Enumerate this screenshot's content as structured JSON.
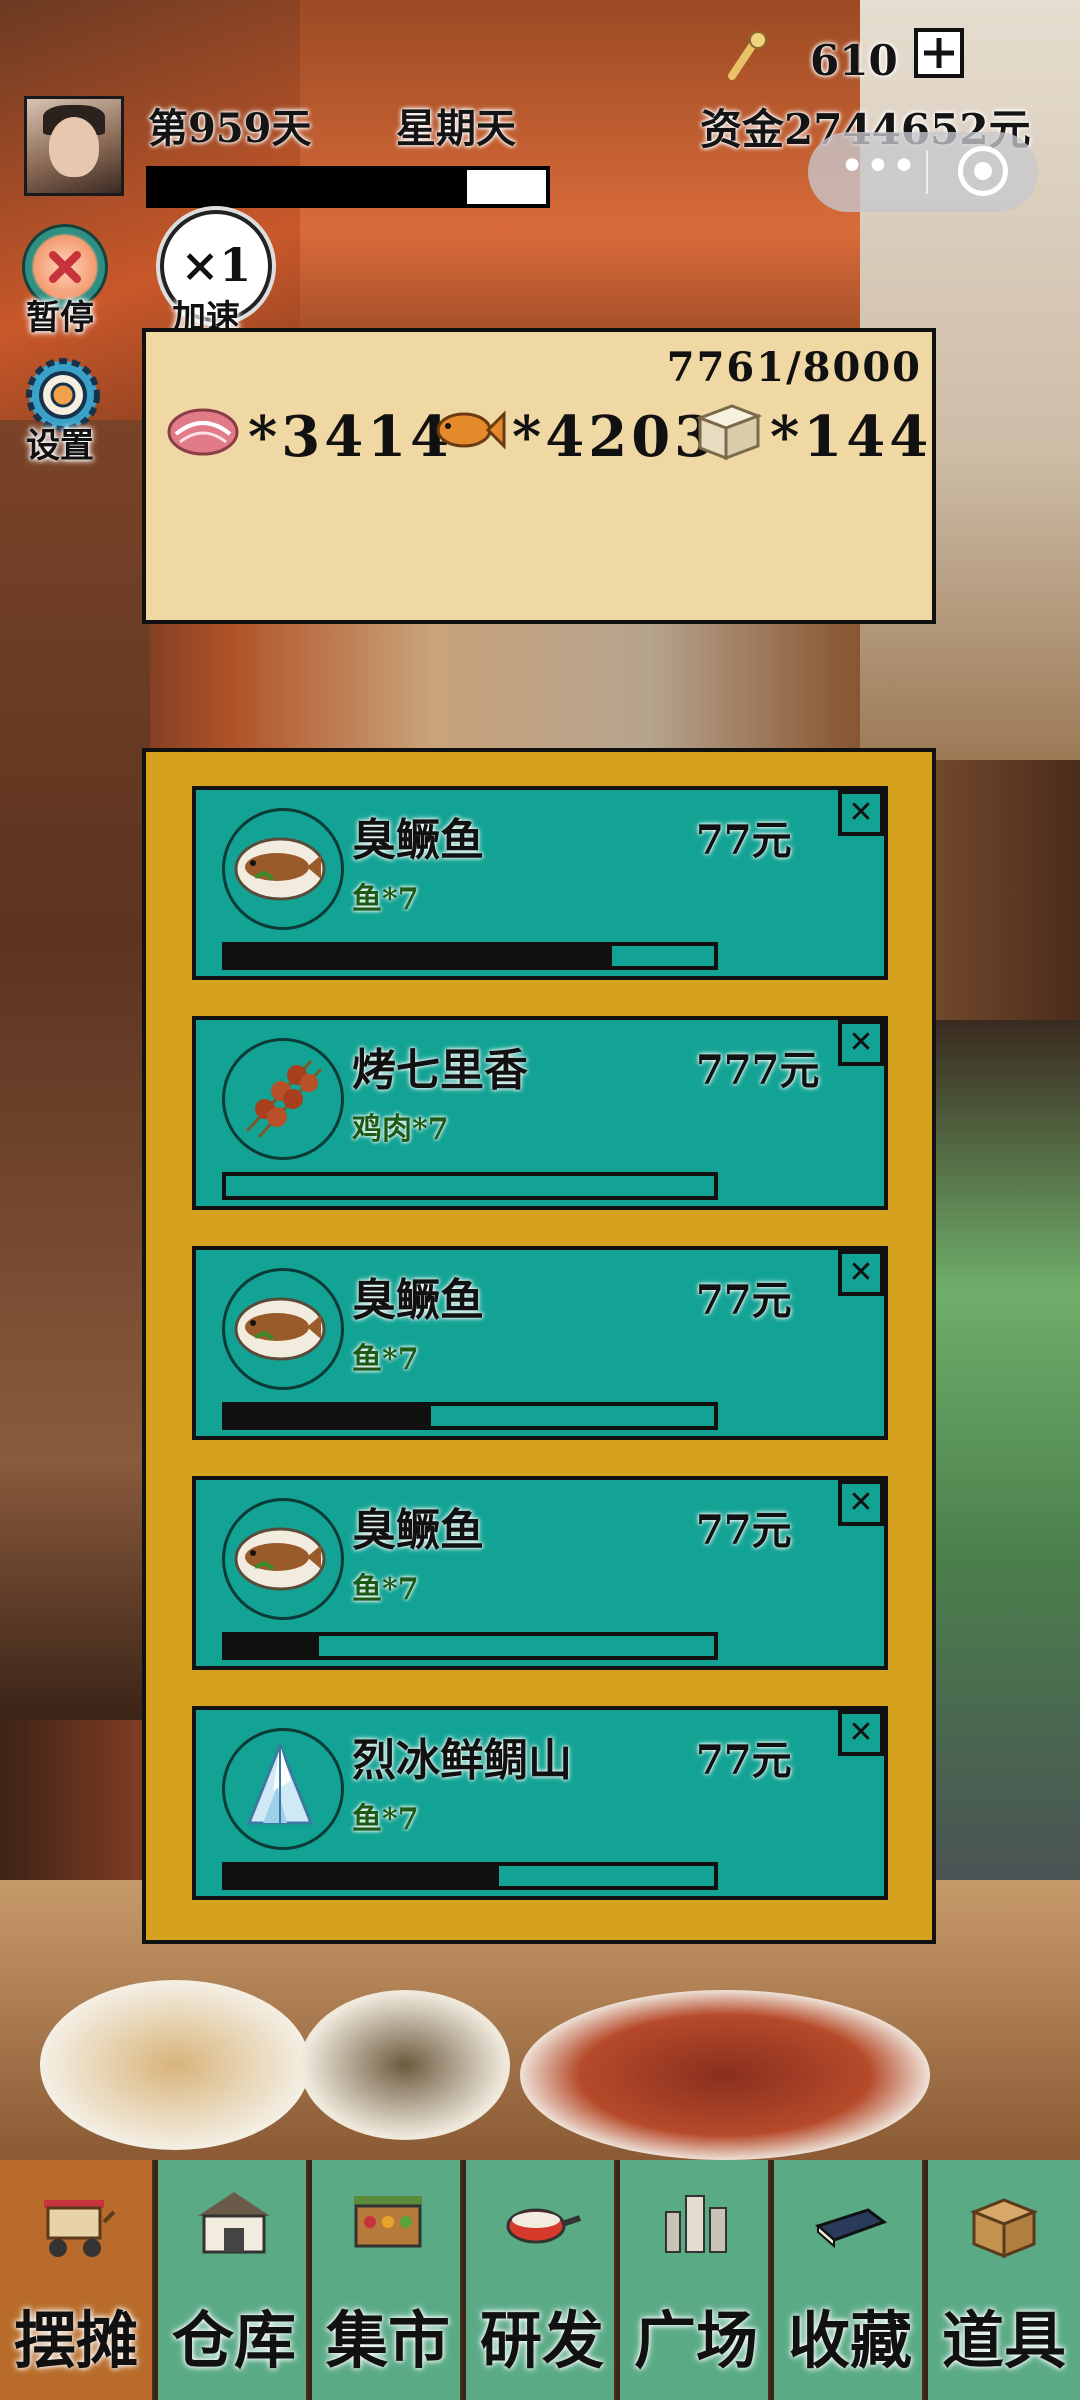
{
  "status": {
    "day": "第959天",
    "weekday": "星期天",
    "key_count": "610",
    "funds": "资金2744652元",
    "progress": 0.8
  },
  "controls": {
    "pause_label": "暂停",
    "speed_value": "×1",
    "speed_label": "加速",
    "settings_label": "设置"
  },
  "inventory": {
    "capacity": "7761/8000",
    "items": [
      {
        "name": "meat-icon",
        "count": "*3414"
      },
      {
        "name": "fish-icon",
        "count": "*4203"
      },
      {
        "name": "tofu-icon",
        "count": "*144"
      }
    ]
  },
  "orders": [
    {
      "name": "臭鳜鱼",
      "price": "77元",
      "requirement": "鱼*7",
      "progress": 0.79,
      "icon": "fish-dish-icon"
    },
    {
      "name": "烤七里香",
      "price": "777元",
      "requirement": "鸡肉*7",
      "progress": 0.0,
      "icon": "skewer-icon"
    },
    {
      "name": "臭鳜鱼",
      "price": "77元",
      "requirement": "鱼*7",
      "progress": 0.42,
      "icon": "fish-dish-icon"
    },
    {
      "name": "臭鳜鱼",
      "price": "77元",
      "requirement": "鱼*7",
      "progress": 0.19,
      "icon": "fish-dish-icon"
    },
    {
      "name": "烈冰鲜鲷山",
      "price": "77元",
      "requirement": "鱼*7",
      "progress": 0.56,
      "icon": "ice-mountain-icon"
    }
  ],
  "tabs": [
    {
      "label": "摆摊",
      "icon": "food-cart-icon",
      "active": true
    },
    {
      "label": "仓库",
      "icon": "warehouse-icon",
      "active": false
    },
    {
      "label": "集市",
      "icon": "market-icon",
      "active": false
    },
    {
      "label": "研发",
      "icon": "pan-icon",
      "active": false
    },
    {
      "label": "广场",
      "icon": "plaza-icon",
      "active": false
    },
    {
      "label": "收藏",
      "icon": "book-icon",
      "active": false
    },
    {
      "label": "道具",
      "icon": "box-icon",
      "active": false
    }
  ]
}
